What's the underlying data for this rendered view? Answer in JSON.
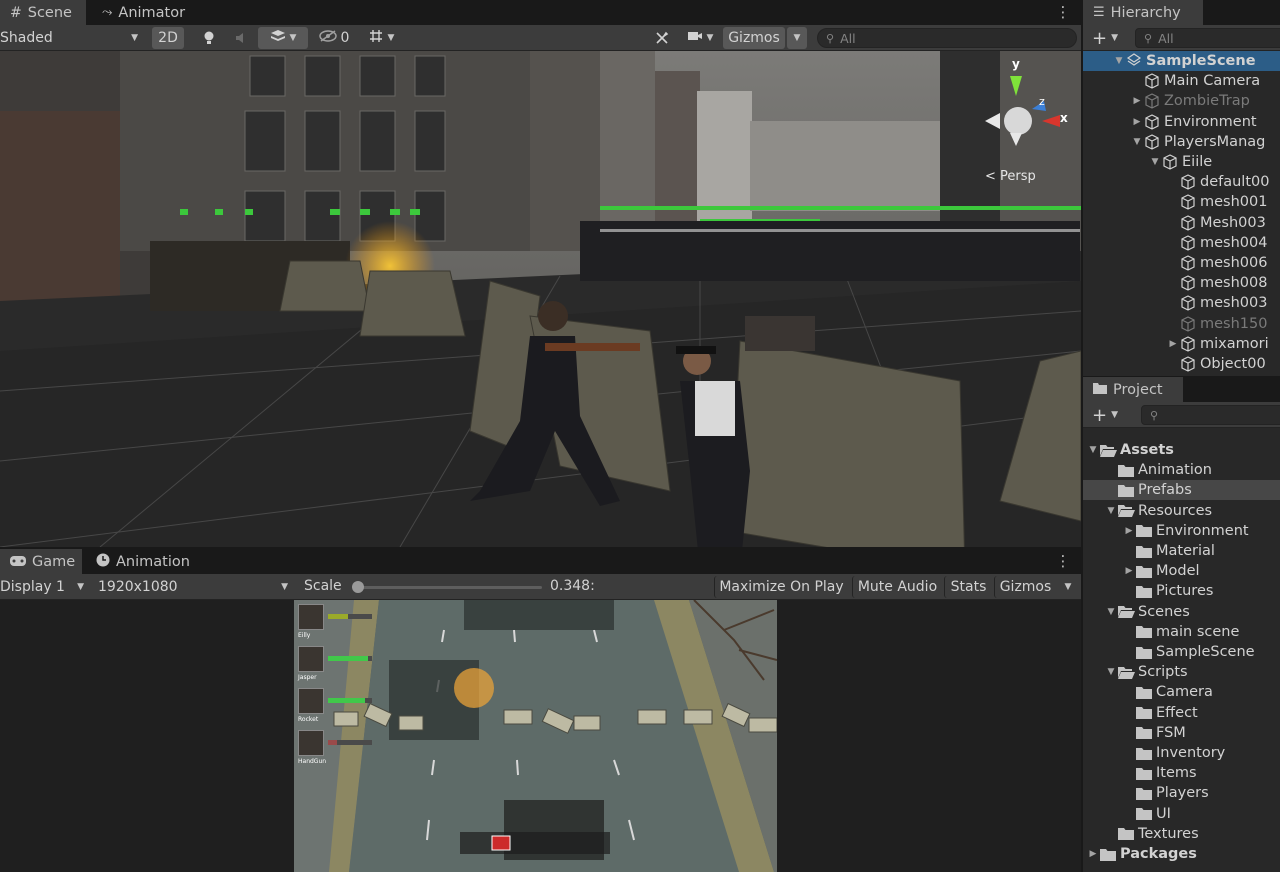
{
  "scene_panel": {
    "tabs": [
      {
        "label": "Scene"
      },
      {
        "label": "Animator"
      }
    ],
    "draw_mode": "Shaded",
    "btn_2d": "2D",
    "hidden_count": "0",
    "gizmos": "Gizmos",
    "search_placeholder": "All",
    "persp_label": "< Persp",
    "axis": {
      "x": "x",
      "y": "y",
      "z": "z"
    }
  },
  "game_panel": {
    "tabs": [
      {
        "label": "Game"
      },
      {
        "label": "Animation"
      }
    ],
    "display": "Display 1",
    "resolution": "1920x1080",
    "scale_label": "Scale",
    "scale_value": "0.348:",
    "scale_fraction": 0.0,
    "maximize": "Maximize On Play",
    "mute": "Mute Audio",
    "stats": "Stats",
    "gizmos": "Gizmos",
    "players": [
      {
        "name": "Eilly",
        "health": 0.45,
        "color": "#9aaa2a"
      },
      {
        "name": "Jasper",
        "health": 0.9,
        "color": "#41c84a"
      },
      {
        "name": "Rocket",
        "health": 0.85,
        "color": "#41c84a"
      },
      {
        "name": "HandGun",
        "health": 0.0,
        "color": "#9a4a4a"
      }
    ]
  },
  "hierarchy": {
    "tab": "Hierarchy",
    "search_placeholder": "All",
    "items": [
      {
        "label": "SampleScene",
        "depth": 0,
        "arrow": "down",
        "icon": "unity-scene-icon",
        "state": "selected",
        "bold": true
      },
      {
        "label": "Main Camera",
        "depth": 1,
        "arrow": "",
        "icon": "cube-icon",
        "state": ""
      },
      {
        "label": "ZombieTrap",
        "depth": 1,
        "arrow": "right",
        "icon": "cube-icon",
        "state": "dim"
      },
      {
        "label": "Environment",
        "depth": 1,
        "arrow": "right",
        "icon": "cube-icon",
        "state": ""
      },
      {
        "label": "PlayersManag",
        "depth": 1,
        "arrow": "down",
        "icon": "cube-icon",
        "state": ""
      },
      {
        "label": "Eiile",
        "depth": 2,
        "arrow": "down",
        "icon": "cube-icon",
        "state": ""
      },
      {
        "label": "default00",
        "depth": 3,
        "arrow": "",
        "icon": "cube-icon",
        "state": ""
      },
      {
        "label": "mesh001",
        "depth": 3,
        "arrow": "",
        "icon": "cube-icon",
        "state": ""
      },
      {
        "label": "Mesh003",
        "depth": 3,
        "arrow": "",
        "icon": "cube-icon",
        "state": ""
      },
      {
        "label": "mesh004",
        "depth": 3,
        "arrow": "",
        "icon": "cube-icon",
        "state": ""
      },
      {
        "label": "mesh006",
        "depth": 3,
        "arrow": "",
        "icon": "cube-icon",
        "state": ""
      },
      {
        "label": "mesh008",
        "depth": 3,
        "arrow": "",
        "icon": "cube-icon",
        "state": ""
      },
      {
        "label": "mesh003",
        "depth": 3,
        "arrow": "",
        "icon": "cube-icon",
        "state": ""
      },
      {
        "label": "mesh150",
        "depth": 3,
        "arrow": "",
        "icon": "cube-icon",
        "state": "dim"
      },
      {
        "label": "mixamori",
        "depth": 3,
        "arrow": "right",
        "icon": "cube-icon",
        "state": ""
      },
      {
        "label": "Object00",
        "depth": 3,
        "arrow": "",
        "icon": "cube-icon",
        "state": ""
      }
    ]
  },
  "project": {
    "tab": "Project",
    "items": [
      {
        "label": "Assets",
        "depth": 0,
        "arrow": "down",
        "icon": "folder-open-icon",
        "state": "",
        "bold": true
      },
      {
        "label": "Animation",
        "depth": 1,
        "arrow": "",
        "icon": "folder-icon",
        "state": ""
      },
      {
        "label": "Prefabs",
        "depth": 1,
        "arrow": "",
        "icon": "folder-icon",
        "state": "highlight"
      },
      {
        "label": "Resources",
        "depth": 1,
        "arrow": "down",
        "icon": "folder-open-icon",
        "state": ""
      },
      {
        "label": "Environment",
        "depth": 2,
        "arrow": "right",
        "icon": "folder-icon",
        "state": ""
      },
      {
        "label": "Material",
        "depth": 2,
        "arrow": "",
        "icon": "folder-icon",
        "state": ""
      },
      {
        "label": "Model",
        "depth": 2,
        "arrow": "right",
        "icon": "folder-icon",
        "state": ""
      },
      {
        "label": "Pictures",
        "depth": 2,
        "arrow": "",
        "icon": "folder-icon",
        "state": ""
      },
      {
        "label": "Scenes",
        "depth": 1,
        "arrow": "down",
        "icon": "folder-open-icon",
        "state": ""
      },
      {
        "label": "main scene",
        "depth": 2,
        "arrow": "",
        "icon": "folder-icon",
        "state": ""
      },
      {
        "label": "SampleScene",
        "depth": 2,
        "arrow": "",
        "icon": "folder-icon",
        "state": ""
      },
      {
        "label": "Scripts",
        "depth": 1,
        "arrow": "down",
        "icon": "folder-open-icon",
        "state": ""
      },
      {
        "label": "Camera",
        "depth": 2,
        "arrow": "",
        "icon": "folder-icon",
        "state": ""
      },
      {
        "label": "Effect",
        "depth": 2,
        "arrow": "",
        "icon": "folder-icon",
        "state": ""
      },
      {
        "label": "FSM",
        "depth": 2,
        "arrow": "",
        "icon": "folder-icon",
        "state": ""
      },
      {
        "label": "Inventory",
        "depth": 2,
        "arrow": "",
        "icon": "folder-icon",
        "state": ""
      },
      {
        "label": "Items",
        "depth": 2,
        "arrow": "",
        "icon": "folder-icon",
        "state": ""
      },
      {
        "label": "Players",
        "depth": 2,
        "arrow": "",
        "icon": "folder-icon",
        "state": ""
      },
      {
        "label": "UI",
        "depth": 2,
        "arrow": "",
        "icon": "folder-icon",
        "state": ""
      },
      {
        "label": "Textures",
        "depth": 1,
        "arrow": "",
        "icon": "folder-icon",
        "state": ""
      },
      {
        "label": "Packages",
        "depth": 0,
        "arrow": "right",
        "icon": "folder-icon",
        "state": "",
        "bold": true
      }
    ]
  }
}
